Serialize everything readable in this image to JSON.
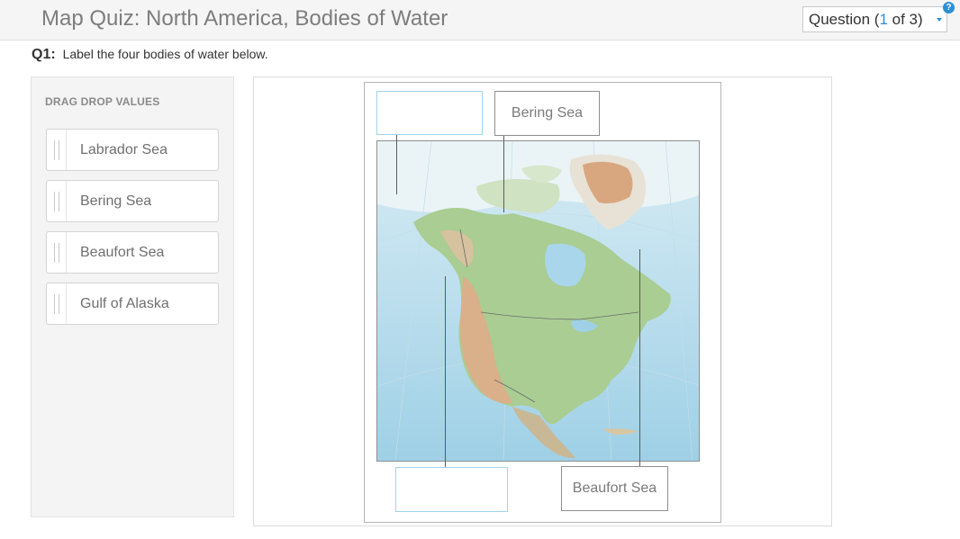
{
  "header": {
    "title": "Map Quiz: North America, Bodies of Water",
    "question_selector": {
      "prefix": "Question (",
      "current": "1",
      "suffix": " of 3)"
    },
    "help_icon": "?"
  },
  "prompt": {
    "number": "Q1:",
    "text": "Label the four bodies of water below."
  },
  "drag_panel": {
    "title": "DRAG DROP VALUES",
    "items": [
      {
        "label": "Labrador Sea"
      },
      {
        "label": "Bering Sea"
      },
      {
        "label": "Beaufort Sea"
      },
      {
        "label": "Gulf of Alaska"
      }
    ]
  },
  "drop_zones": {
    "top_left": "",
    "top_right": "Bering Sea",
    "bottom_left": "",
    "bottom_right": "Beaufort Sea"
  },
  "colors": {
    "accent": "#2d8fd5",
    "empty_drop_border": "#9fd5ea",
    "ocean": "#a9d6ea",
    "land_green": "#9cc48a",
    "land_tan": "#d8b48c",
    "ice": "#eef5f8"
  }
}
